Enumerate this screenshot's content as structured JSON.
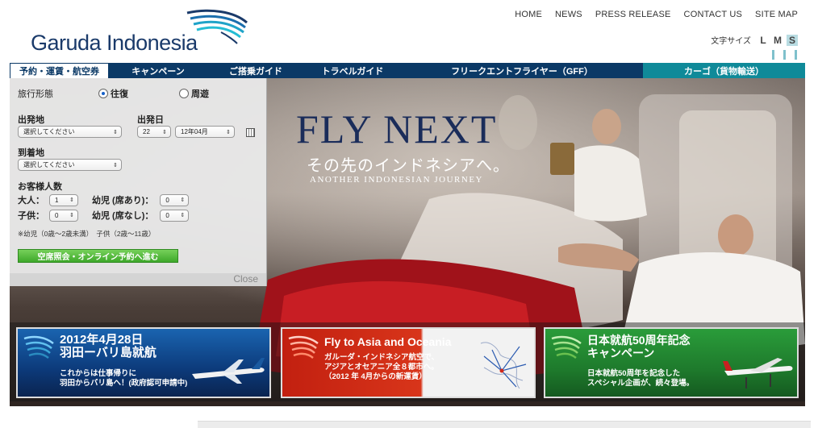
{
  "brand": {
    "name": "Garuda Indonesia"
  },
  "topnav": [
    {
      "label": "HOME"
    },
    {
      "label": "NEWS"
    },
    {
      "label": "PRESS RELEASE"
    },
    {
      "label": "CONTACT US"
    },
    {
      "label": "SITE MAP"
    }
  ],
  "fontsize": {
    "label": "文字サイズ",
    "options": [
      "L",
      "M",
      "S"
    ],
    "selected": "S"
  },
  "mainnav": [
    {
      "label": "予約・運賃・航空券",
      "active": true
    },
    {
      "label": "キャンペーン"
    },
    {
      "label": "ご搭乗ガイド"
    },
    {
      "label": "トラベルガイド"
    },
    {
      "label": "フリークエントフライヤー（GFF）"
    },
    {
      "label": "カーゴ（貨物輸送）"
    }
  ],
  "booking": {
    "trip_type_label": "旅行形態",
    "round_trip": "往復",
    "circle_trip": "周遊",
    "trip_selected": "往復",
    "departure_label": "出発地",
    "departure_value": "選択してください",
    "date_label": "出発日",
    "day_value": "22",
    "month_value": "12年04月",
    "arrival_label": "到着地",
    "arrival_value": "選択してください",
    "pax_label": "お客様人数",
    "adult_label": "大人：",
    "adult_value": "1",
    "child_label": "子供：",
    "child_value": "0",
    "infant_seat_label": "幼児 (席あり)：",
    "infant_seat_value": "0",
    "infant_noseat_label": "幼児 (席なし)：",
    "infant_noseat_value": "0",
    "note": "※幼児（0歳〜2歳未満）　子供（2歳〜11歳）",
    "submit": "空席照会・オンライン予約へ進む",
    "close": "Close"
  },
  "hero": {
    "headline": "FLY NEXT",
    "subheadline": "その先のインドネシアへ。",
    "tagline": "ANOTHER INDONESIAN JOURNEY"
  },
  "banners": [
    {
      "title_line1": "2012年4月28日",
      "title_line2": "羽田ーバリ島就航",
      "text_line1": "これからは仕事帰りに",
      "text_line2": "羽田からバリ島へ！(政府認可申請中)"
    },
    {
      "title_line1": "Fly to Asia and Oceania",
      "text_line1": "ガルーダ・インドネシア航空で、",
      "text_line2": "アジアとオセアニア全８都市へ。",
      "text_line3": "（2012 年 4月からの新運賃）"
    },
    {
      "title_line1": "日本就航50周年記念",
      "title_line2": "キャンペーン",
      "text_line1": "日本就航50周年を記念した",
      "text_line2": "スペシャル企画が、続々登場。"
    }
  ],
  "colors": {
    "navy": "#0b3966",
    "teal": "#0f8a99",
    "green": "#3ea82a"
  }
}
